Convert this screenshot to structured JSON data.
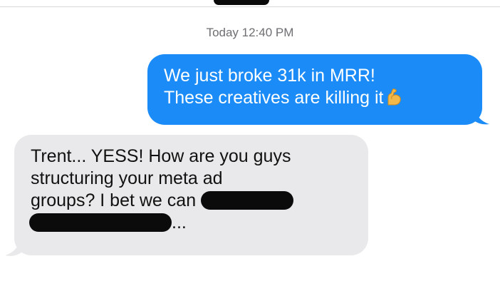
{
  "conversation": {
    "timestamp": "Today 12:40 PM",
    "messages": [
      {
        "direction": "outgoing",
        "lines": [
          "We just broke 31k in MRR!",
          "These creatives are killing it"
        ],
        "emoji": "flexed-biceps"
      },
      {
        "direction": "incoming",
        "lines": [
          "Trent... YESS! How are you guys",
          "structuring your meta ad",
          "groups? I bet we can",
          "..."
        ],
        "redacted": true
      }
    ]
  },
  "colors": {
    "outgoing_bubble": "#1b8cf7",
    "incoming_bubble": "#e9e9eb",
    "redaction": "#0b0b0b"
  }
}
